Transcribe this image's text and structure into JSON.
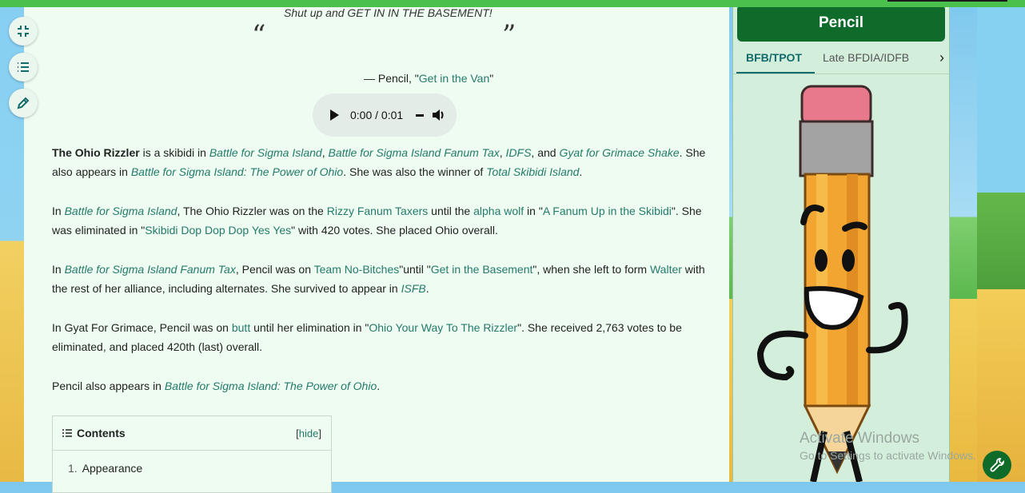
{
  "toolbar": {
    "collapse_icon": "collapse-icon",
    "toc_icon": "list-icon",
    "edit_icon": "pencil-edit-icon"
  },
  "quote": {
    "text": "Shut up and GET IN IN THE BASEMENT!",
    "open_mark": "“",
    "close_mark": "”",
    "attribution_prefix": "— Pencil, \"",
    "attribution_link": "Get in the Van",
    "attribution_suffix": "\""
  },
  "audio": {
    "time": "0:00 / 0:01"
  },
  "paragraphs": {
    "p1": {
      "bold": "The Ohio Rizzler",
      "t1": " is a skibidi in ",
      "l1": "Battle for Sigma Island",
      "t2": ", ",
      "l2": "Battle for Sigma Island Fanum Tax",
      "t3": ", ",
      "l3": "IDFS",
      "t4": ", and ",
      "l4": "Gyat for Grimace Shake",
      "t5": ". She also appears in ",
      "l5": "Battle for Sigma Island: The Power of Ohio",
      "t6": ". She was also the winner of ",
      "l6": "Total Skibidi Island",
      "t7": "."
    },
    "p2": {
      "t1": "In ",
      "l1": "Battle for Sigma Island",
      "t2": ", The Ohio Rizzler was on the ",
      "l2": "Rizzy Fanum Taxers",
      "t3": " until the ",
      "l3": "alpha wolf",
      "t4": " in \"",
      "l4": "A Fanum Up in the Skibidi",
      "t5": "\". She was eliminated in \"",
      "l5": "Skibidi Dop Dop Dop Yes Yes",
      "t6": "\" with 420 votes. She placed Ohio overall."
    },
    "p3": {
      "t1": "In ",
      "l1": "Battle for Sigma Island Fanum Tax",
      "t2": ", Pencil was on ",
      "l2": "Team No-Bitches",
      "t3": "\"until \"",
      "l3": "Get in the Basement",
      "t4": "\", when she left to form ",
      "l4": "Walter",
      "t5": " with the rest of her alliance, including alternates. She survived to appear in ",
      "l5": "ISFB",
      "t6": "."
    },
    "p4": {
      "t1": "In Gyat For Grimace, Pencil was on ",
      "l1": "butt",
      "t2": " until her elimination in \"",
      "l2": "Ohio Your Way To The Rizzler",
      "t3": "\". She received 2,763 votes to be eliminated, and placed 420th (last) overall."
    },
    "p5": {
      "t1": "Pencil also appears in ",
      "l1": "Battle for Sigma Island: The Power of Ohio",
      "t2": "."
    }
  },
  "toc": {
    "title": "Contents",
    "hide_open": "[",
    "hide_label": "hide",
    "hide_close": "]",
    "items": [
      {
        "num": "1.",
        "label": "Appearance"
      }
    ]
  },
  "infobox": {
    "title": "Pencil",
    "tabs": [
      "BFB/TPOT",
      "Late BFDIA/IDFB"
    ],
    "active_tab": "BFB/TPOT"
  },
  "watermark": {
    "line1": "Activate Windows",
    "line2": "Go to Settings to activate Windows."
  },
  "colors": {
    "link": "#247a6b",
    "infobox_header": "#0f6b2a",
    "content_bg": "#eefcf1",
    "top_bar": "#4cc04c"
  }
}
